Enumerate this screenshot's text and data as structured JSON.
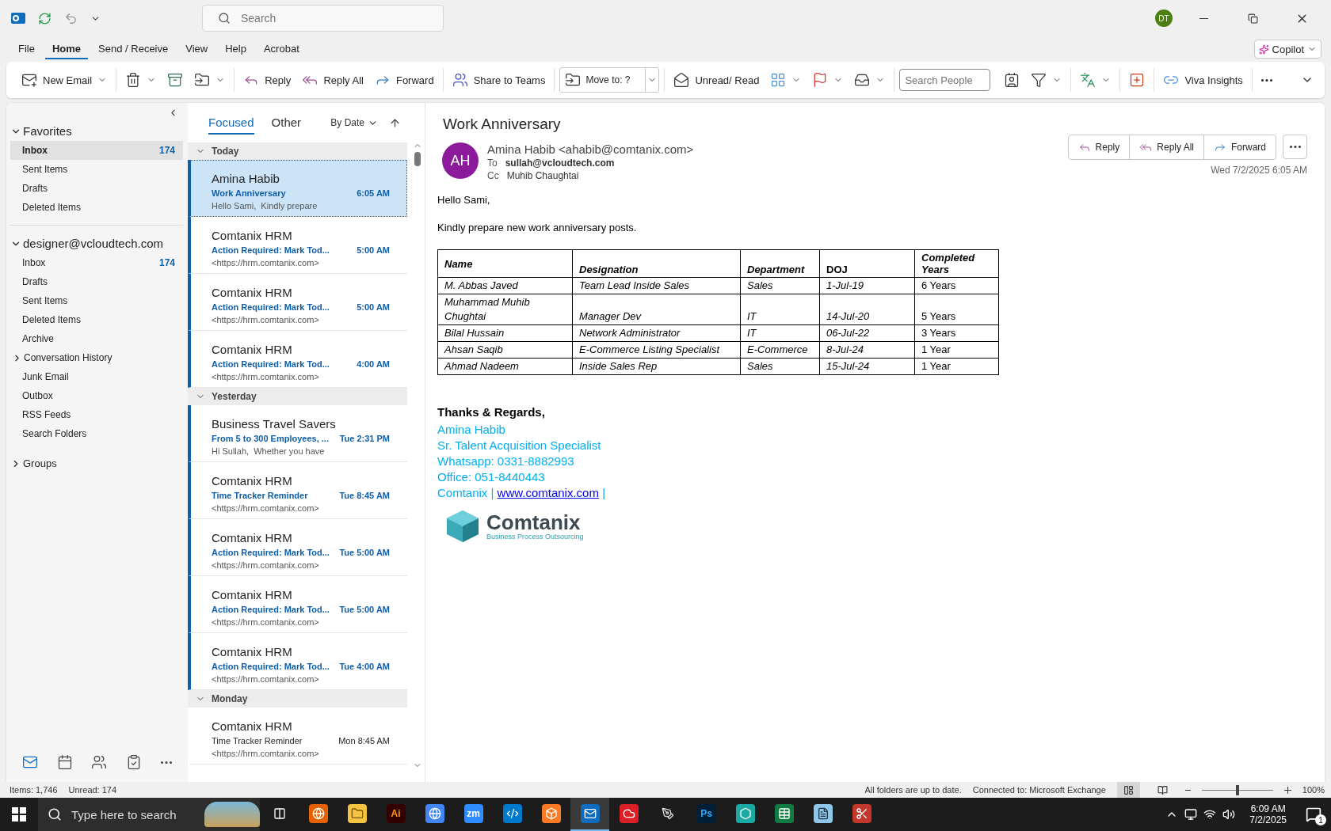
{
  "title_bar": {
    "search_placeholder": "Search",
    "avatar": "DT"
  },
  "menu_tabs": [
    {
      "label": "File",
      "selected": false
    },
    {
      "label": "Home",
      "selected": true
    },
    {
      "label": "Send / Receive",
      "selected": false
    },
    {
      "label": "View",
      "selected": false
    },
    {
      "label": "Help",
      "selected": false
    },
    {
      "label": "Acrobat",
      "selected": false
    }
  ],
  "copilot": "Copilot",
  "ribbon": {
    "groups": [
      [
        {
          "kind": "button",
          "label": "New Email",
          "menu": true
        }
      ],
      [
        {
          "kind": "icon",
          "menu": true
        },
        {
          "kind": "icon",
          "menu": false
        },
        {
          "kind": "icon",
          "menu": true
        }
      ],
      [
        {
          "kind": "button",
          "label": "Reply",
          "menu": false
        },
        {
          "kind": "button",
          "label": "Reply All",
          "menu": false
        },
        {
          "kind": "button",
          "label": "Forward",
          "menu": false
        }
      ],
      [
        {
          "kind": "button",
          "label": "Share to Teams",
          "menu": false
        }
      ],
      [
        {
          "kind": "dropdown",
          "label": "Move to: ?",
          "menu": true
        }
      ],
      [
        {
          "kind": "button",
          "label": "Unread/ Read",
          "menu": false
        },
        {
          "kind": "icon",
          "menu": true
        },
        {
          "kind": "icon",
          "menu": true
        },
        {
          "kind": "icon",
          "menu": true
        }
      ],
      [
        {
          "kind": "search",
          "placeholder": "Search People"
        },
        {
          "kind": "icon",
          "menu": false
        },
        {
          "kind": "icon",
          "menu": true
        }
      ],
      [
        {
          "kind": "icon",
          "menu": true
        }
      ],
      [
        {
          "kind": "icon",
          "menu": false
        }
      ],
      [
        {
          "kind": "button",
          "label": "Viva Insights",
          "menu": false
        }
      ],
      [
        {
          "kind": "icon",
          "menu": false
        }
      ]
    ]
  },
  "folder_pane": {
    "sections": [
      {
        "label": "Favorites",
        "expanded": true,
        "items": [
          {
            "label": "Inbox",
            "count": "174",
            "selected": true
          },
          {
            "label": "Sent Items",
            "selected": false
          },
          {
            "label": "Drafts",
            "selected": false
          },
          {
            "label": "Deleted Items",
            "selected": false
          }
        ]
      },
      {
        "label": "designer@vcloudtech.com",
        "expanded": true,
        "items": [
          {
            "label": "Inbox",
            "count": "174",
            "selected": false
          },
          {
            "label": "Drafts",
            "selected": false
          },
          {
            "label": "Sent Items",
            "selected": false
          },
          {
            "label": "Deleted Items",
            "selected": false
          },
          {
            "label": "Archive",
            "selected": false
          },
          {
            "label": "Conversation History",
            "expanded": false,
            "selected": false
          },
          {
            "label": "Junk Email",
            "selected": false
          },
          {
            "label": "Outbox",
            "selected": false
          },
          {
            "label": "RSS Feeds",
            "selected": false
          },
          {
            "label": "Search Folders",
            "selected": false
          }
        ]
      },
      {
        "label": "Groups",
        "expanded": false
      }
    ],
    "modules": [
      {
        "selected": true
      },
      {
        "selected": false
      },
      {
        "selected": false
      },
      {
        "selected": false
      },
      {
        "selected": false
      }
    ]
  },
  "message_list": {
    "tabs": [
      {
        "label": "Focused",
        "selected": true
      },
      {
        "label": "Other",
        "selected": false
      }
    ],
    "sort": "By Date",
    "groups": [
      {
        "label": "Today",
        "expanded": true,
        "messages": [
          {
            "sender": "Amina Habib",
            "subject": "Work Anniversary",
            "time": "6:05 AM",
            "preview": "Hello Sami,  Kindly prepare",
            "unread": true,
            "selected": true
          },
          {
            "sender": "Comtanix HRM",
            "subject": "Action Required: Mark Tod...",
            "time": "5:00 AM",
            "preview": "<https://hrm.comtanix.com>",
            "unread": true,
            "selected": false
          },
          {
            "sender": "Comtanix HRM",
            "subject": "Action Required: Mark Tod...",
            "time": "5:00 AM",
            "preview": "<https://hrm.comtanix.com>",
            "unread": true,
            "selected": false
          },
          {
            "sender": "Comtanix HRM",
            "subject": "Action Required: Mark Tod...",
            "time": "4:00 AM",
            "preview": "<https://hrm.comtanix.com>",
            "unread": true,
            "selected": false
          }
        ]
      },
      {
        "label": "Yesterday",
        "expanded": true,
        "messages": [
          {
            "sender": "Business Travel Savers",
            "subject": "From 5 to 300 Employees, ...",
            "time": "Tue 2:31 PM",
            "preview": "Hi Sullah,  Whether you have",
            "unread": true,
            "selected": false
          },
          {
            "sender": "Comtanix HRM",
            "subject": "Time Tracker Reminder",
            "time": "Tue 8:45 AM",
            "preview": "<https://hrm.comtanix.com>",
            "unread": true,
            "selected": false
          },
          {
            "sender": "Comtanix HRM",
            "subject": "Action Required: Mark Tod...",
            "time": "Tue 5:00 AM",
            "preview": "<https://hrm.comtanix.com>",
            "unread": true,
            "selected": false
          },
          {
            "sender": "Comtanix HRM",
            "subject": "Action Required: Mark Tod...",
            "time": "Tue 5:00 AM",
            "preview": "<https://hrm.comtanix.com>",
            "unread": true,
            "selected": false
          },
          {
            "sender": "Comtanix HRM",
            "subject": "Action Required: Mark Tod...",
            "time": "Tue 4:00 AM",
            "preview": "<https://hrm.comtanix.com>",
            "unread": true,
            "selected": false
          }
        ]
      },
      {
        "label": "Monday",
        "expanded": true,
        "messages": [
          {
            "sender": "Comtanix HRM",
            "subject": "Time Tracker Reminder",
            "time": "Mon 8:45 AM",
            "preview": "<https://hrm.comtanix.com>",
            "unread": false,
            "selected": false
          }
        ]
      }
    ]
  },
  "reading_pane": {
    "subject": "Work Anniversary",
    "avatar": "AH",
    "sender": "Amina Habib <ahabib@comtanix.com>",
    "to_label": "To",
    "to": "sullah@vcloudtech.com",
    "cc_label": "Cc",
    "cc": "Muhib Chaughtai",
    "actions": [
      "Reply",
      "Reply All",
      "Forward"
    ],
    "date": "Wed 7/2/2025 6:05 AM",
    "greeting": "Hello Sami,",
    "paragraph": "Kindly prepare new work anniversary posts.",
    "table": {
      "columns": [
        "Name",
        "Designation",
        "Department",
        "DOJ",
        "Completed Years"
      ],
      "rows": [
        [
          "M. Abbas Javed",
          "Team Lead Inside Sales",
          "Sales",
          "1-Jul-19",
          "6 Years"
        ],
        [
          "Muhammad Muhib Chughtai",
          "Manager Dev",
          "IT",
          "14-Jul-20",
          "5 Years"
        ],
        [
          "Bilal Hussain",
          "Network Administrator",
          "IT",
          "06-Jul-22",
          "3 Years"
        ],
        [
          "Ahsan Saqib",
          "E-Commerce Listing Specialist",
          "E-Commerce",
          "8-Jul-24",
          "1 Year"
        ],
        [
          "Ahmad Nadeem",
          "Inside Sales Rep",
          "Sales",
          "15-Jul-24",
          "1 Year"
        ]
      ]
    },
    "signature": {
      "closing": "Thanks & Regards,",
      "lines": [
        "Amina Habib",
        "Sr. Talent Acquisition Specialist",
        "Whatsapp: 0331-8882993",
        "Office: 051-8440443"
      ],
      "company": "Comtanix |",
      "link": "www.comtanix.com",
      "trailing": "|"
    },
    "logo": {
      "name": "Comtanix",
      "tagline": "Business Process Outsourcing"
    }
  },
  "status_bar": {
    "items": "Items: 1,746",
    "unread": "Unread: 174",
    "sync": "All folders are up to date.",
    "connection": "Connected to: Microsoft Exchange",
    "zoom": {
      "level": 0.5,
      "reading": "100%"
    }
  },
  "taskbar": {
    "search_placeholder": "Type here to search",
    "apps": [
      {
        "selected": false
      },
      {
        "selected": false
      },
      {
        "selected": false
      },
      {
        "label": "Ai",
        "selected": false
      },
      {
        "selected": false
      },
      {
        "label": "zm",
        "selected": false
      },
      {
        "selected": false
      },
      {
        "selected": false
      },
      {
        "selected": true
      },
      {
        "selected": false
      },
      {
        "selected": false
      },
      {
        "label": "Ps",
        "selected": false
      },
      {
        "selected": false
      },
      {
        "selected": false
      },
      {
        "selected": false
      },
      {
        "selected": false
      }
    ],
    "time": "6:09 AM",
    "date": "7/2/2025",
    "notifications": "1"
  }
}
